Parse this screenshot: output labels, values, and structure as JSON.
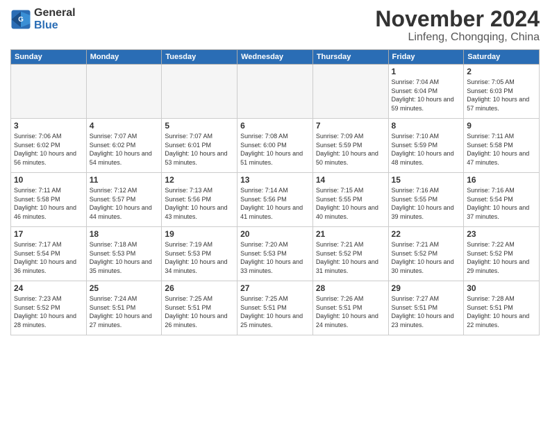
{
  "logo": {
    "general": "General",
    "blue": "Blue"
  },
  "header": {
    "month": "November 2024",
    "location": "Linfeng, Chongqing, China"
  },
  "weekdays": [
    "Sunday",
    "Monday",
    "Tuesday",
    "Wednesday",
    "Thursday",
    "Friday",
    "Saturday"
  ],
  "weeks": [
    [
      {
        "day": "",
        "info": "",
        "empty": true
      },
      {
        "day": "",
        "info": "",
        "empty": true
      },
      {
        "day": "",
        "info": "",
        "empty": true
      },
      {
        "day": "",
        "info": "",
        "empty": true
      },
      {
        "day": "",
        "info": "",
        "empty": true
      },
      {
        "day": "1",
        "info": "Sunrise: 7:04 AM\nSunset: 6:04 PM\nDaylight: 10 hours and 59 minutes."
      },
      {
        "day": "2",
        "info": "Sunrise: 7:05 AM\nSunset: 6:03 PM\nDaylight: 10 hours and 57 minutes."
      }
    ],
    [
      {
        "day": "3",
        "info": "Sunrise: 7:06 AM\nSunset: 6:02 PM\nDaylight: 10 hours and 56 minutes."
      },
      {
        "day": "4",
        "info": "Sunrise: 7:07 AM\nSunset: 6:02 PM\nDaylight: 10 hours and 54 minutes."
      },
      {
        "day": "5",
        "info": "Sunrise: 7:07 AM\nSunset: 6:01 PM\nDaylight: 10 hours and 53 minutes."
      },
      {
        "day": "6",
        "info": "Sunrise: 7:08 AM\nSunset: 6:00 PM\nDaylight: 10 hours and 51 minutes."
      },
      {
        "day": "7",
        "info": "Sunrise: 7:09 AM\nSunset: 5:59 PM\nDaylight: 10 hours and 50 minutes."
      },
      {
        "day": "8",
        "info": "Sunrise: 7:10 AM\nSunset: 5:59 PM\nDaylight: 10 hours and 48 minutes."
      },
      {
        "day": "9",
        "info": "Sunrise: 7:11 AM\nSunset: 5:58 PM\nDaylight: 10 hours and 47 minutes."
      }
    ],
    [
      {
        "day": "10",
        "info": "Sunrise: 7:11 AM\nSunset: 5:58 PM\nDaylight: 10 hours and 46 minutes."
      },
      {
        "day": "11",
        "info": "Sunrise: 7:12 AM\nSunset: 5:57 PM\nDaylight: 10 hours and 44 minutes."
      },
      {
        "day": "12",
        "info": "Sunrise: 7:13 AM\nSunset: 5:56 PM\nDaylight: 10 hours and 43 minutes."
      },
      {
        "day": "13",
        "info": "Sunrise: 7:14 AM\nSunset: 5:56 PM\nDaylight: 10 hours and 41 minutes."
      },
      {
        "day": "14",
        "info": "Sunrise: 7:15 AM\nSunset: 5:55 PM\nDaylight: 10 hours and 40 minutes."
      },
      {
        "day": "15",
        "info": "Sunrise: 7:16 AM\nSunset: 5:55 PM\nDaylight: 10 hours and 39 minutes."
      },
      {
        "day": "16",
        "info": "Sunrise: 7:16 AM\nSunset: 5:54 PM\nDaylight: 10 hours and 37 minutes."
      }
    ],
    [
      {
        "day": "17",
        "info": "Sunrise: 7:17 AM\nSunset: 5:54 PM\nDaylight: 10 hours and 36 minutes."
      },
      {
        "day": "18",
        "info": "Sunrise: 7:18 AM\nSunset: 5:53 PM\nDaylight: 10 hours and 35 minutes."
      },
      {
        "day": "19",
        "info": "Sunrise: 7:19 AM\nSunset: 5:53 PM\nDaylight: 10 hours and 34 minutes."
      },
      {
        "day": "20",
        "info": "Sunrise: 7:20 AM\nSunset: 5:53 PM\nDaylight: 10 hours and 33 minutes."
      },
      {
        "day": "21",
        "info": "Sunrise: 7:21 AM\nSunset: 5:52 PM\nDaylight: 10 hours and 31 minutes."
      },
      {
        "day": "22",
        "info": "Sunrise: 7:21 AM\nSunset: 5:52 PM\nDaylight: 10 hours and 30 minutes."
      },
      {
        "day": "23",
        "info": "Sunrise: 7:22 AM\nSunset: 5:52 PM\nDaylight: 10 hours and 29 minutes."
      }
    ],
    [
      {
        "day": "24",
        "info": "Sunrise: 7:23 AM\nSunset: 5:52 PM\nDaylight: 10 hours and 28 minutes."
      },
      {
        "day": "25",
        "info": "Sunrise: 7:24 AM\nSunset: 5:51 PM\nDaylight: 10 hours and 27 minutes."
      },
      {
        "day": "26",
        "info": "Sunrise: 7:25 AM\nSunset: 5:51 PM\nDaylight: 10 hours and 26 minutes."
      },
      {
        "day": "27",
        "info": "Sunrise: 7:25 AM\nSunset: 5:51 PM\nDaylight: 10 hours and 25 minutes."
      },
      {
        "day": "28",
        "info": "Sunrise: 7:26 AM\nSunset: 5:51 PM\nDaylight: 10 hours and 24 minutes."
      },
      {
        "day": "29",
        "info": "Sunrise: 7:27 AM\nSunset: 5:51 PM\nDaylight: 10 hours and 23 minutes."
      },
      {
        "day": "30",
        "info": "Sunrise: 7:28 AM\nSunset: 5:51 PM\nDaylight: 10 hours and 22 minutes."
      }
    ]
  ]
}
